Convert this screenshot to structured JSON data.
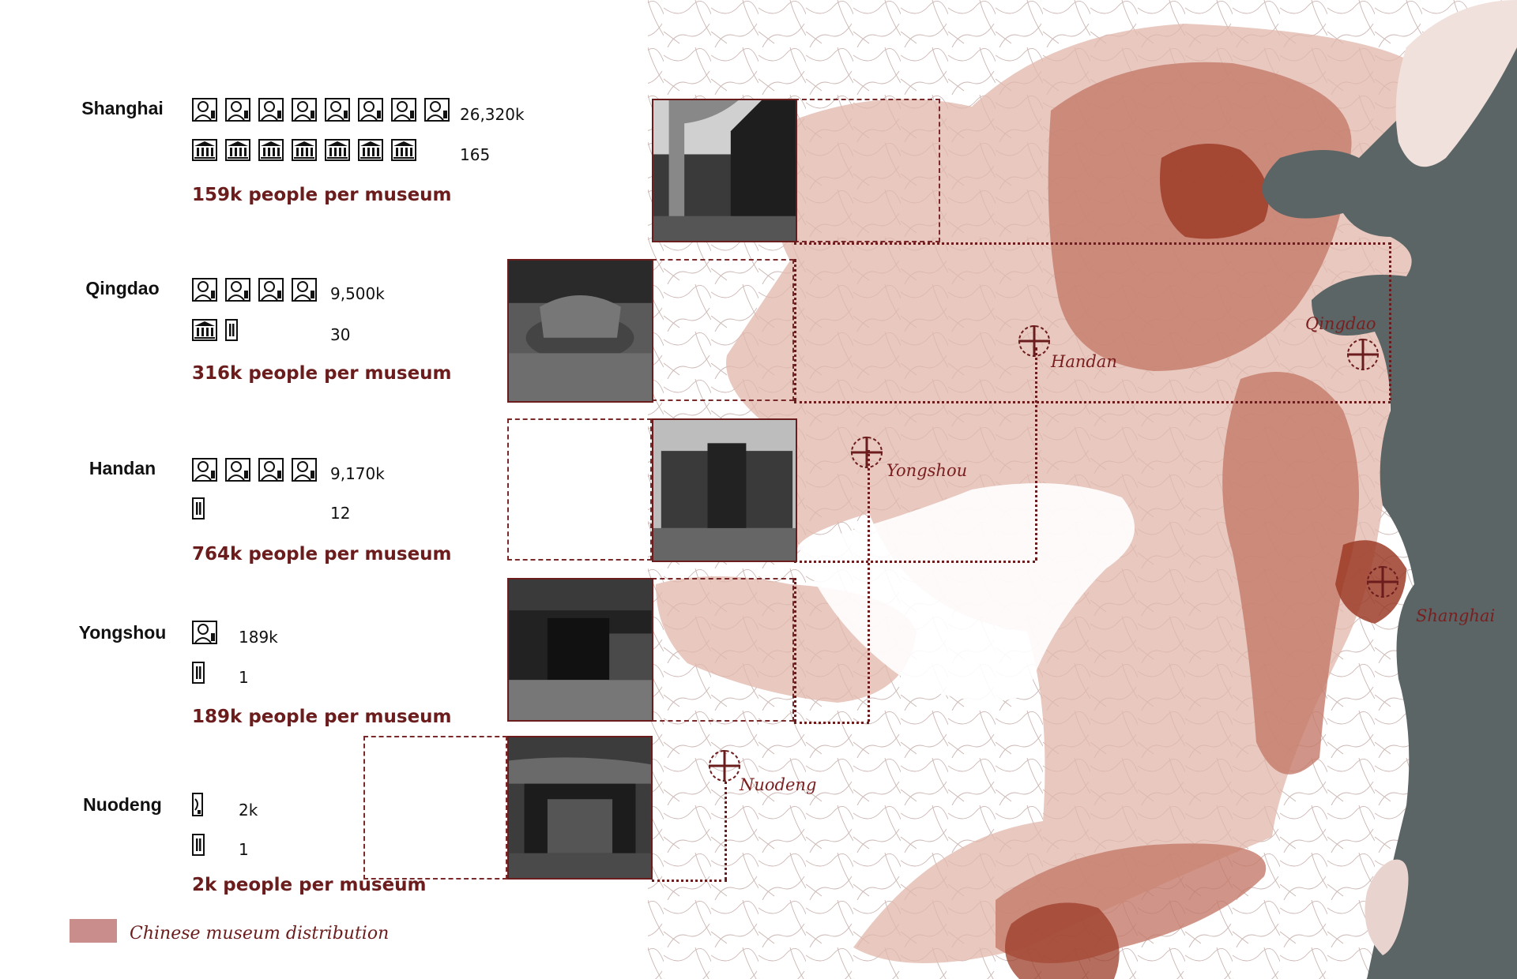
{
  "cities": [
    {
      "name": "Shanghai",
      "population": "26,320k",
      "museums": "165",
      "ratio": "159k people per museum"
    },
    {
      "name": "Qingdao",
      "population": "9,500k",
      "museums": "30",
      "ratio": "316k people per museum"
    },
    {
      "name": "Handan",
      "population": "9,170k",
      "museums": "12",
      "ratio": "764k people per museum"
    },
    {
      "name": "Yongshou",
      "population": "189k",
      "museums": "1",
      "ratio": "189k people per museum"
    },
    {
      "name": "Nuodeng",
      "population": "2k",
      "museums": "1",
      "ratio": "2k people per museum"
    }
  ],
  "map_labels": {
    "shanghai": "Shanghai",
    "qingdao": "Qingdao",
    "handan": "Handan",
    "yongshou": "Yongshou",
    "nuodeng": "Nuodeng"
  },
  "legend": {
    "label": "Chinese museum distribution"
  },
  "icons": {
    "person": "person-icon",
    "museum": "museum-icon",
    "marker": "crosshair-marker-icon"
  },
  "colors": {
    "sea": "#5b6566",
    "light_area": "#e6c3bb",
    "mid_area": "#c47b6a",
    "dark_area": "#9c3c28",
    "accent": "#6b1c1c"
  }
}
